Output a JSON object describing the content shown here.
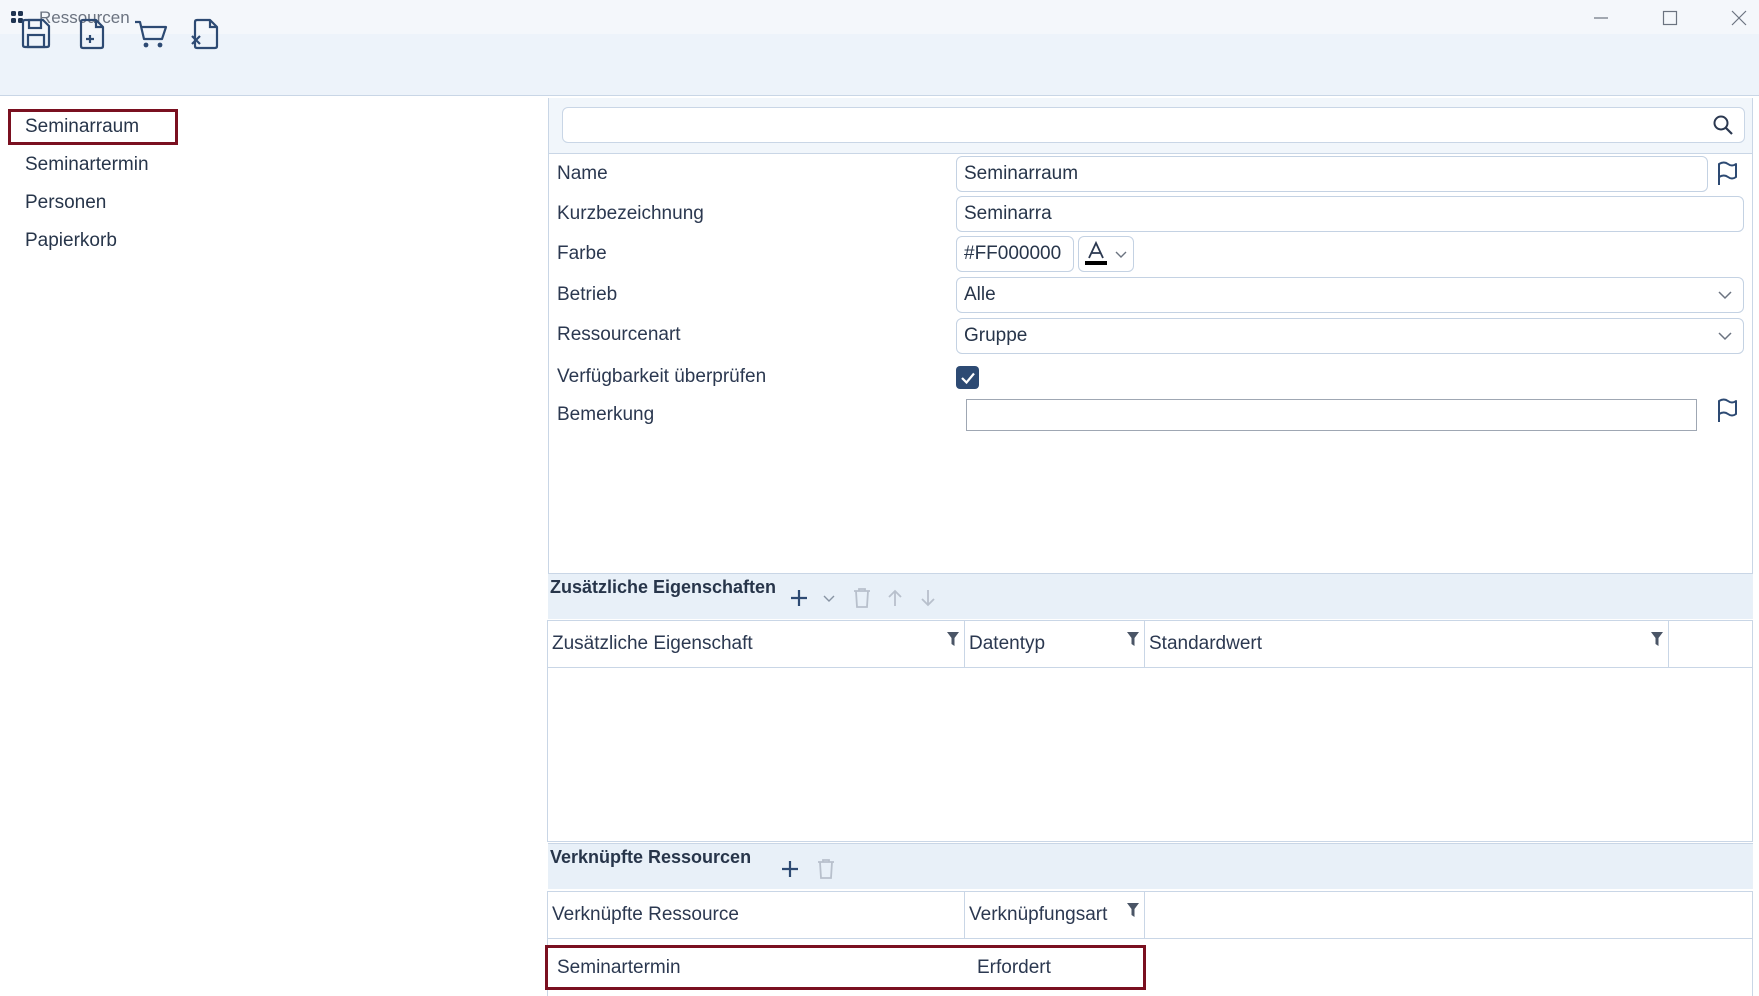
{
  "window": {
    "title": "Ressourcen"
  },
  "toolbar": {
    "icons": [
      "save-icon",
      "new-document-icon",
      "cart-icon",
      "discard-document-icon"
    ]
  },
  "nav": {
    "items": [
      {
        "label": "Seminarraum",
        "selected": true
      },
      {
        "label": "Seminartermin",
        "selected": false
      },
      {
        "label": "Personen",
        "selected": false
      },
      {
        "label": "Papierkorb",
        "selected": false
      }
    ]
  },
  "search": {
    "value": ""
  },
  "form": {
    "name_label": "Name",
    "name_value": "Seminarraum",
    "short_label": "Kurzbezeichnung",
    "short_value": "Seminarra",
    "color_label": "Farbe",
    "color_value": "#FF000000",
    "company_label": "Betrieb",
    "company_value": "Alle",
    "type_label": "Ressourcenart",
    "type_value": "Gruppe",
    "availability_label": "Verfügbarkeit überprüfen",
    "availability_checked": true,
    "remark_label": "Bemerkung",
    "remark_value": ""
  },
  "props": {
    "title": "Zusätzliche Eigenschaften",
    "columns": [
      "Zusätzliche Eigenschaft",
      "Datentyp",
      "Standardwert"
    ]
  },
  "linked": {
    "title": "Verknüpfte Ressourcen",
    "columns": [
      "Verknüpfte Ressource",
      "Verknüpfungsart"
    ],
    "rows": [
      {
        "resource": "Seminartermin",
        "type": "Erfordert"
      }
    ]
  },
  "colors": {
    "accent": "#2d4a73",
    "highlight": "#7a1020",
    "border": "#c9d6e6"
  }
}
